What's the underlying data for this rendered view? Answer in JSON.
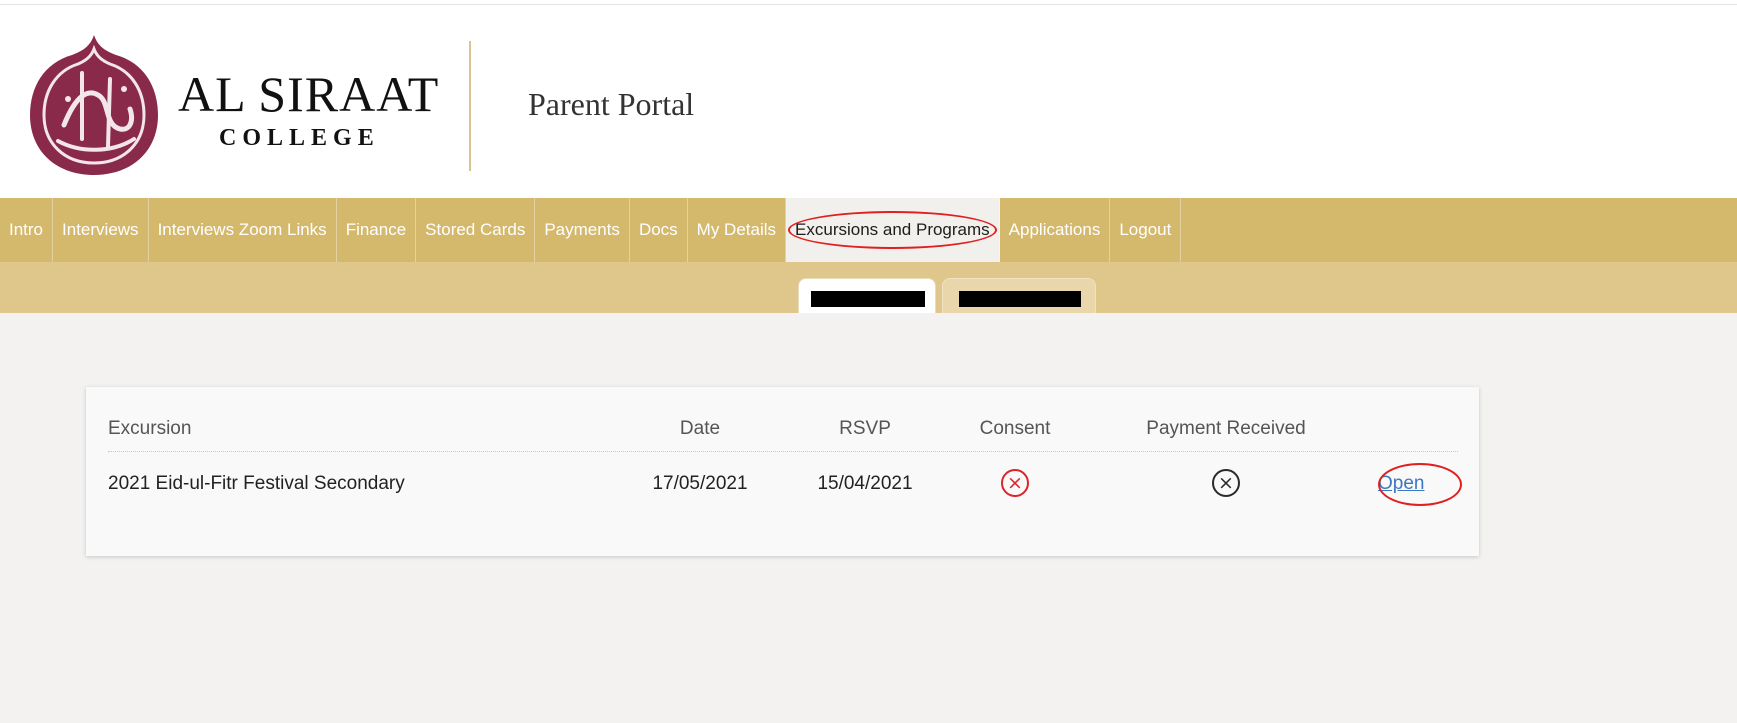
{
  "app": {
    "school_name": "AL SIRAAT",
    "school_sub": "COLLEGE",
    "portal_title": "Parent Portal"
  },
  "nav": {
    "items": [
      {
        "label": "Intro"
      },
      {
        "label": "Interviews"
      },
      {
        "label": "Interviews Zoom Links"
      },
      {
        "label": "Finance"
      },
      {
        "label": "Stored Cards"
      },
      {
        "label": "Payments"
      },
      {
        "label": "Docs"
      },
      {
        "label": "My Details"
      },
      {
        "label": "Excursions and Programs",
        "active": true
      },
      {
        "label": "Applications"
      },
      {
        "label": "Logout"
      }
    ]
  },
  "table": {
    "headers": {
      "excursion": "Excursion",
      "date": "Date",
      "rsvp": "RSVP",
      "consent": "Consent",
      "payment": "Payment Received"
    },
    "rows": [
      {
        "excursion": "2021 Eid-ul-Fitr Festival Secondary",
        "date": "17/05/2021",
        "rsvp": "15/04/2021",
        "consent_icon": "x-circle-icon",
        "payment_icon": "x-circle-icon",
        "action": "Open"
      }
    ]
  },
  "colors": {
    "nav_bg": "#d4b86c",
    "subbar_bg": "#dfc68a",
    "brand_maroon": "#8a2a4a",
    "annotation_red": "#e02020",
    "consent_red": "#d9262b",
    "link_blue": "#3b78c2"
  }
}
